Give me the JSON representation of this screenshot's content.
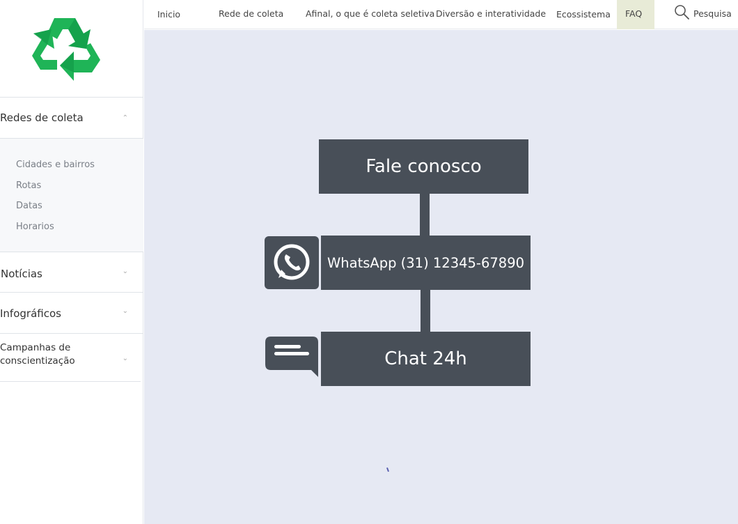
{
  "nav": {
    "items": [
      "Inicio",
      "Rede de coleta",
      "Afinal, o que é coleta seletiva",
      "Diversão e interatividade",
      "Ecossistema",
      "FAQ"
    ],
    "search_label": "Pesquisa"
  },
  "sidebar": {
    "sections": [
      {
        "label": "Redes de coleta",
        "expanded": true,
        "items": [
          "Cidades e bairros",
          "Rotas",
          "Datas",
          "Horarios"
        ]
      },
      {
        "label": "Notícias",
        "expanded": false
      },
      {
        "label": "Infográficos",
        "expanded": false
      },
      {
        "label": "Campanhas de conscientização",
        "line1": "Campanhas de",
        "line2": "conscientização",
        "expanded": false
      }
    ]
  },
  "contact": {
    "title": "Fale conosco",
    "whatsapp": "WhatsApp (31) 12345-67890",
    "chat": "Chat 24h"
  },
  "colors": {
    "accent_green": "#1fb457",
    "box_dark": "#484f58",
    "main_bg": "#e6e9f3",
    "faq_active_bg": "#e8ebd7"
  },
  "icons": {
    "logo": "recycle-icon",
    "search": "search-icon",
    "whatsapp": "whatsapp-icon",
    "chat": "chat-bubble-icon",
    "chevron_up": "chevron-up-icon",
    "chevron_down": "chevron-down-icon"
  }
}
